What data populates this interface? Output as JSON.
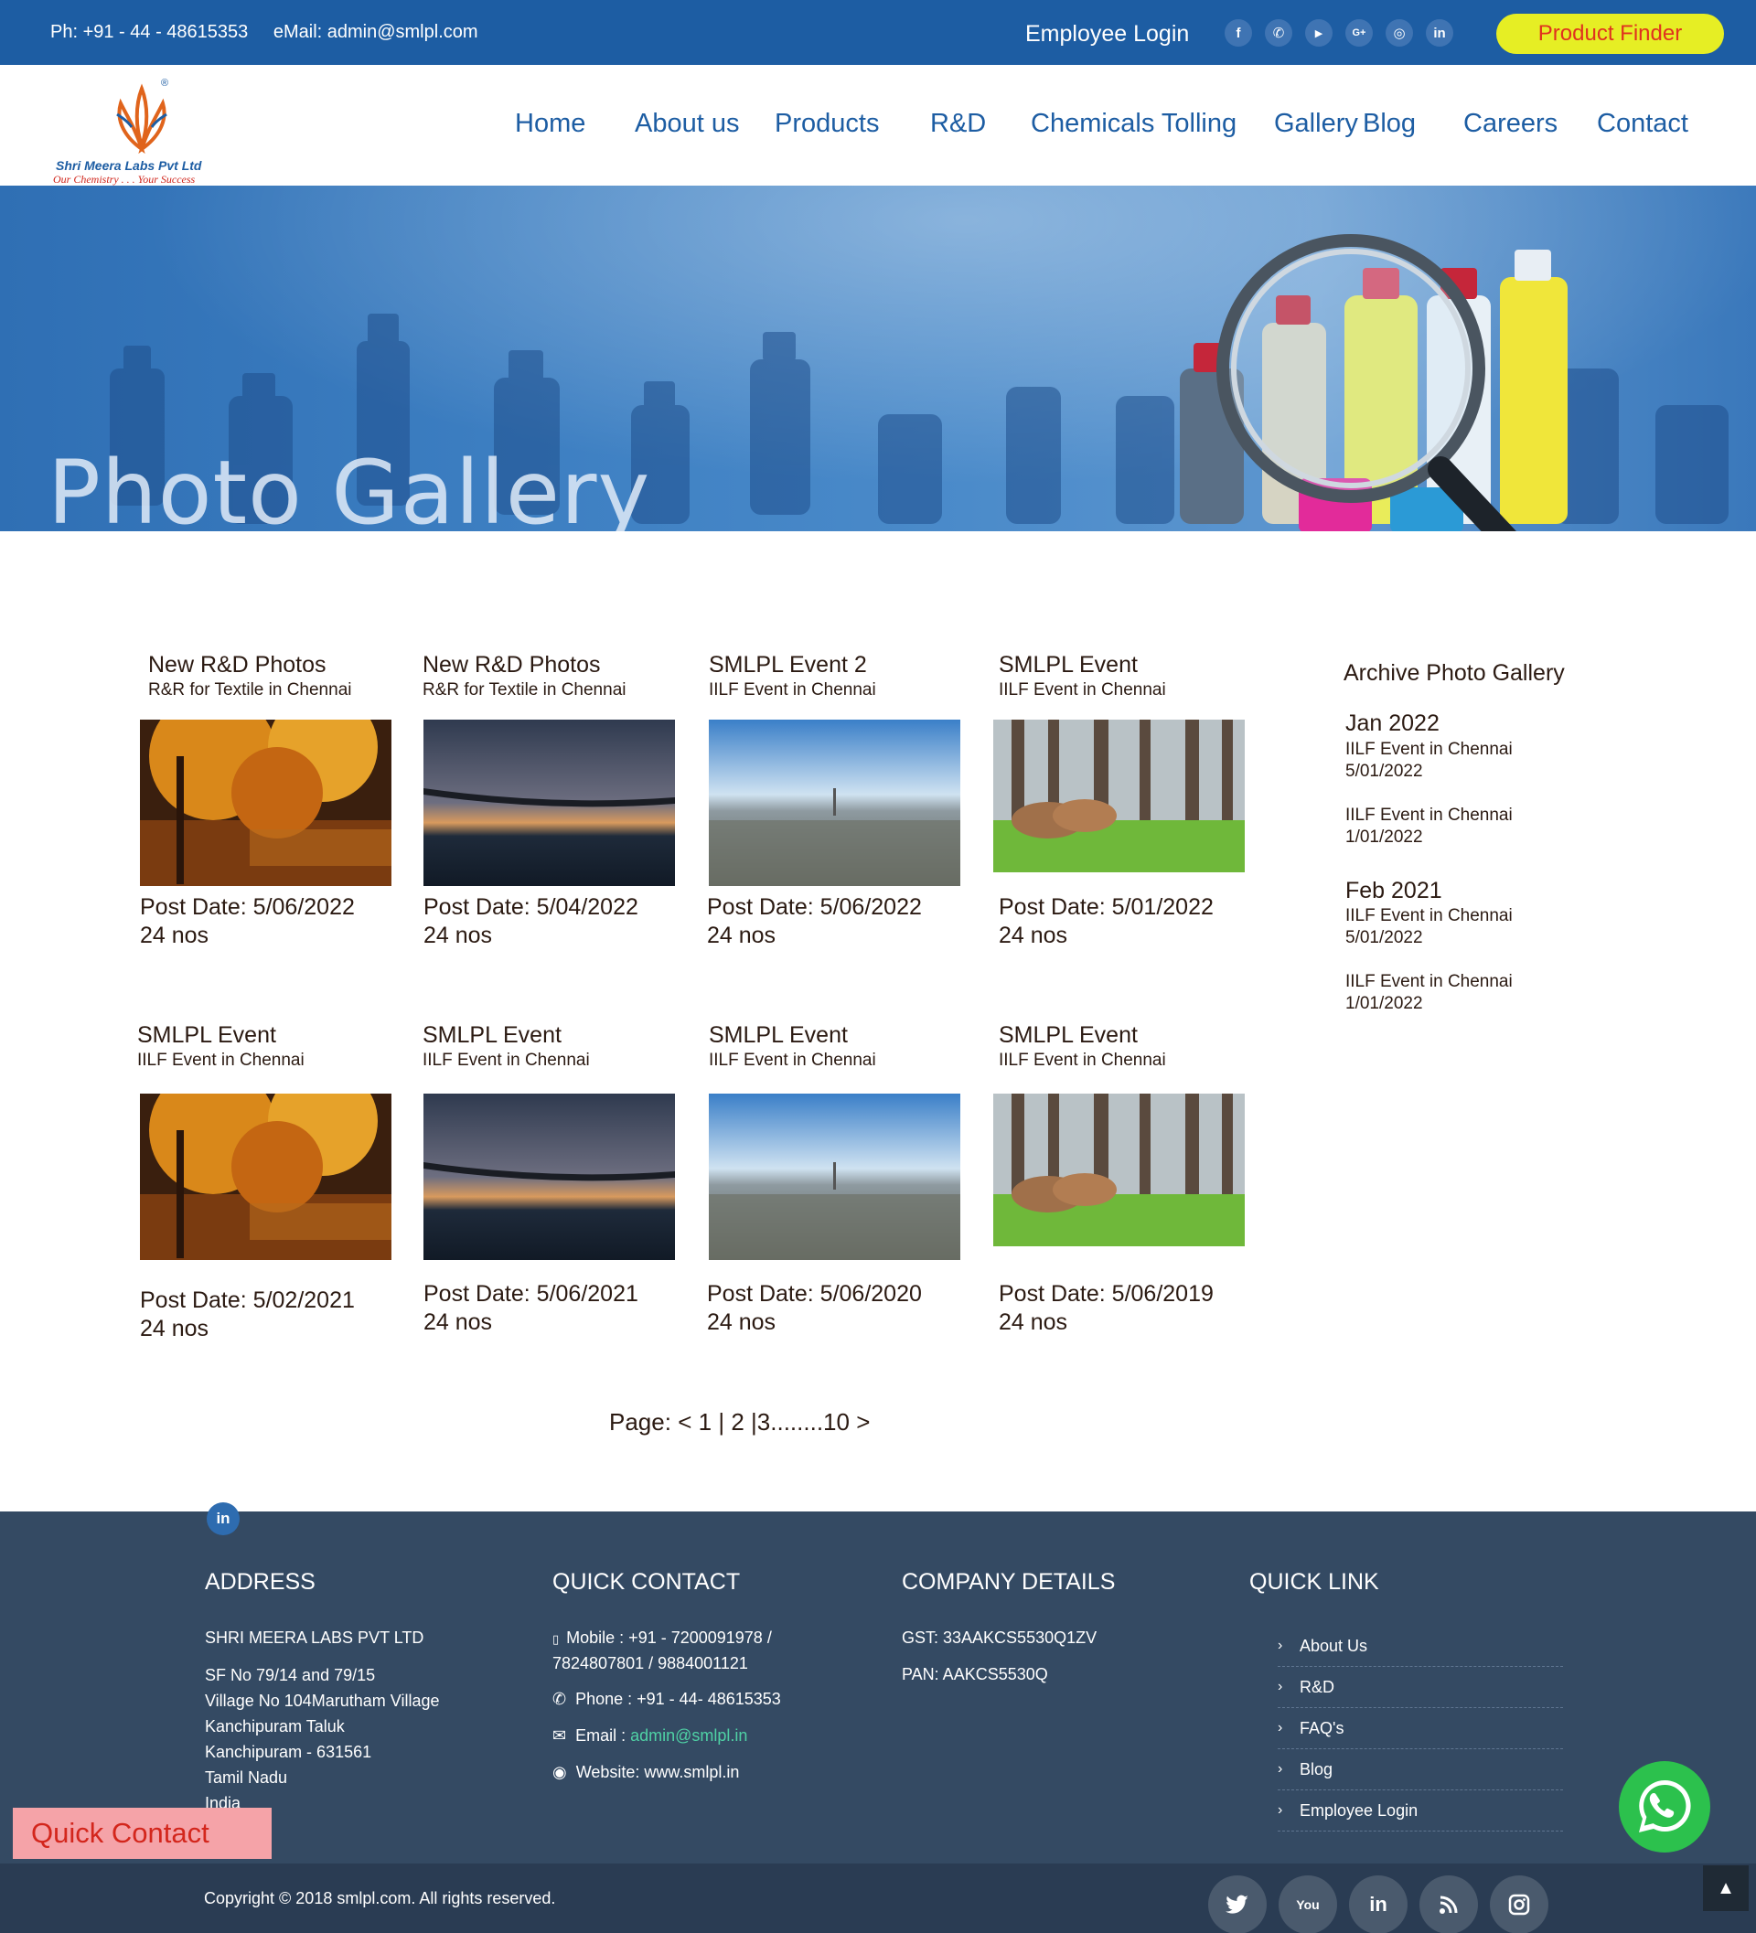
{
  "topbar": {
    "phone": "Ph: +91 - 44 - 48615353",
    "email": "eMail: admin@smlpl.com",
    "employee_login": "Employee Login",
    "product_finder": "Product Finder",
    "social": [
      {
        "icon": "facebook-icon",
        "glyph": "f"
      },
      {
        "icon": "whatsapp-icon",
        "glyph": "✆"
      },
      {
        "icon": "youtube-icon",
        "glyph": "▶"
      },
      {
        "icon": "google-plus-icon",
        "glyph": "G+"
      },
      {
        "icon": "instagram-icon",
        "glyph": "◎"
      },
      {
        "icon": "linkedin-icon",
        "glyph": "in"
      }
    ]
  },
  "brand": {
    "name": "Shri Meera Labs Pvt Ltd",
    "tagline": "Our Chemistry . . . Your Success",
    "registered": "®"
  },
  "nav": [
    "Home",
    "About us",
    "Products",
    "R&D",
    "Chemicals Tolling",
    "Gallery",
    "Blog",
    "Careers",
    "Contact"
  ],
  "banner": {
    "title": "Photo Gallery"
  },
  "gallery": [
    {
      "title": "New R&D Photos",
      "subtitle": "R&R for Textile in Chennai",
      "date": "Post Date: 5/06/2022",
      "count": "24 nos",
      "image": "autumn-lake"
    },
    {
      "title": "New R&D Photos",
      "subtitle": "R&R for Textile in Chennai",
      "date": "Post Date: 5/04/2022",
      "count": "24 nos",
      "image": "bridge-dusk"
    },
    {
      "title": "SMLPL Event 2",
      "subtitle": "IILF Event in Chennai",
      "date": "Post Date: 5/06/2022",
      "count": "24 nos",
      "image": "paris-city"
    },
    {
      "title": "SMLPL Event",
      "subtitle": "IILF Event in Chennai",
      "date": "Post Date: 5/01/2022",
      "count": "24 nos",
      "image": "deer-forest"
    },
    {
      "title": "SMLPL Event",
      "subtitle": "IILF Event in Chennai",
      "date": "Post Date: 5/02/2021",
      "count": "24 nos",
      "image": "autumn-lake"
    },
    {
      "title": "SMLPL Event",
      "subtitle": "IILF Event in Chennai",
      "date": "Post Date: 5/06/2021",
      "count": "24 nos",
      "image": "bridge-dusk"
    },
    {
      "title": "SMLPL Event",
      "subtitle": "IILF Event in Chennai",
      "date": "Post Date: 5/06/2020",
      "count": "24 nos",
      "image": "paris-city"
    },
    {
      "title": "SMLPL Event",
      "subtitle": "IILF Event in Chennai",
      "date": "Post Date: 5/06/2019",
      "count": "24 nos",
      "image": "deer-forest"
    }
  ],
  "pagination": {
    "label": "Page:",
    "prev": "<",
    "p1": "1",
    "sep1": "|",
    "p2": "2",
    "sep2": "|",
    "p3": "3",
    "dots": "........",
    "last": "10",
    "next": ">"
  },
  "archive": {
    "heading": "Archive Photo Gallery",
    "groups": [
      {
        "month": "Jan 2022",
        "entries": [
          {
            "name": "IILF Event in Chennai",
            "date": "5/01/2022"
          },
          {
            "name": "IILF Event in Chennai",
            "date": "1/01/2022"
          }
        ]
      },
      {
        "month": "Feb 2021",
        "entries": [
          {
            "name": "IILF Event in Chennai",
            "date": "5/01/2022"
          },
          {
            "name": "IILF Event in Chennai",
            "date": "1/01/2022"
          }
        ]
      }
    ]
  },
  "footer": {
    "address": {
      "heading": "ADDRESS",
      "company": "SHRI MEERA LABS PVT LTD",
      "lines": [
        "SF No 79/14 and 79/15",
        "Village No 104Marutham Village",
        "Kanchipuram Taluk",
        "Kanchipuram - 631561",
        "Tamil Nadu",
        "India"
      ]
    },
    "quick_contact": {
      "heading": "QUICK CONTACT",
      "mobile_1": "Mobile : +91 - 7200091978 /",
      "mobile_2": "7824807801 / 9884001121",
      "phone": "Phone : +91 - 44- 48615353",
      "email_label": "Email : ",
      "email_value": "admin@smlpl.in",
      "website": "Website: www.smlpl.in"
    },
    "company": {
      "heading": "COMPANY DETAILS",
      "gst": "GST: 33AAKCS5530Q1ZV",
      "pan": "PAN: AAKCS5530Q"
    },
    "quick_links": {
      "heading": "QUICK LINK",
      "items": [
        "About Us",
        "R&D",
        "FAQ's",
        "Blog",
        "Employee Login"
      ]
    },
    "copyright": "Copyright © 2018 smlpl.com. All rights reserved.",
    "social": [
      {
        "icon": "twitter-icon",
        "glyph": "🐦"
      },
      {
        "icon": "youtube-icon",
        "glyph": "You"
      },
      {
        "icon": "linkedin-icon",
        "glyph": "in"
      },
      {
        "icon": "rss-icon",
        "glyph": "))"
      },
      {
        "icon": "instagram-icon",
        "glyph": "◎"
      }
    ],
    "linkedin_badge": "in"
  },
  "floating": {
    "quick_contact": "Quick Contact",
    "whatsapp_icon": "whatsapp-icon",
    "scroll_top_icon": "arrow-up-icon"
  },
  "colors": {
    "brand_blue": "#1d5da3",
    "product_finder_bg": "#e6ee24",
    "product_finder_text": "#e0311f",
    "footer_bg": "#344a63",
    "copyright_bg": "#2a3c53",
    "quick_contact_bg": "#f5a3a8",
    "whatsapp_green": "#2cc14d"
  }
}
